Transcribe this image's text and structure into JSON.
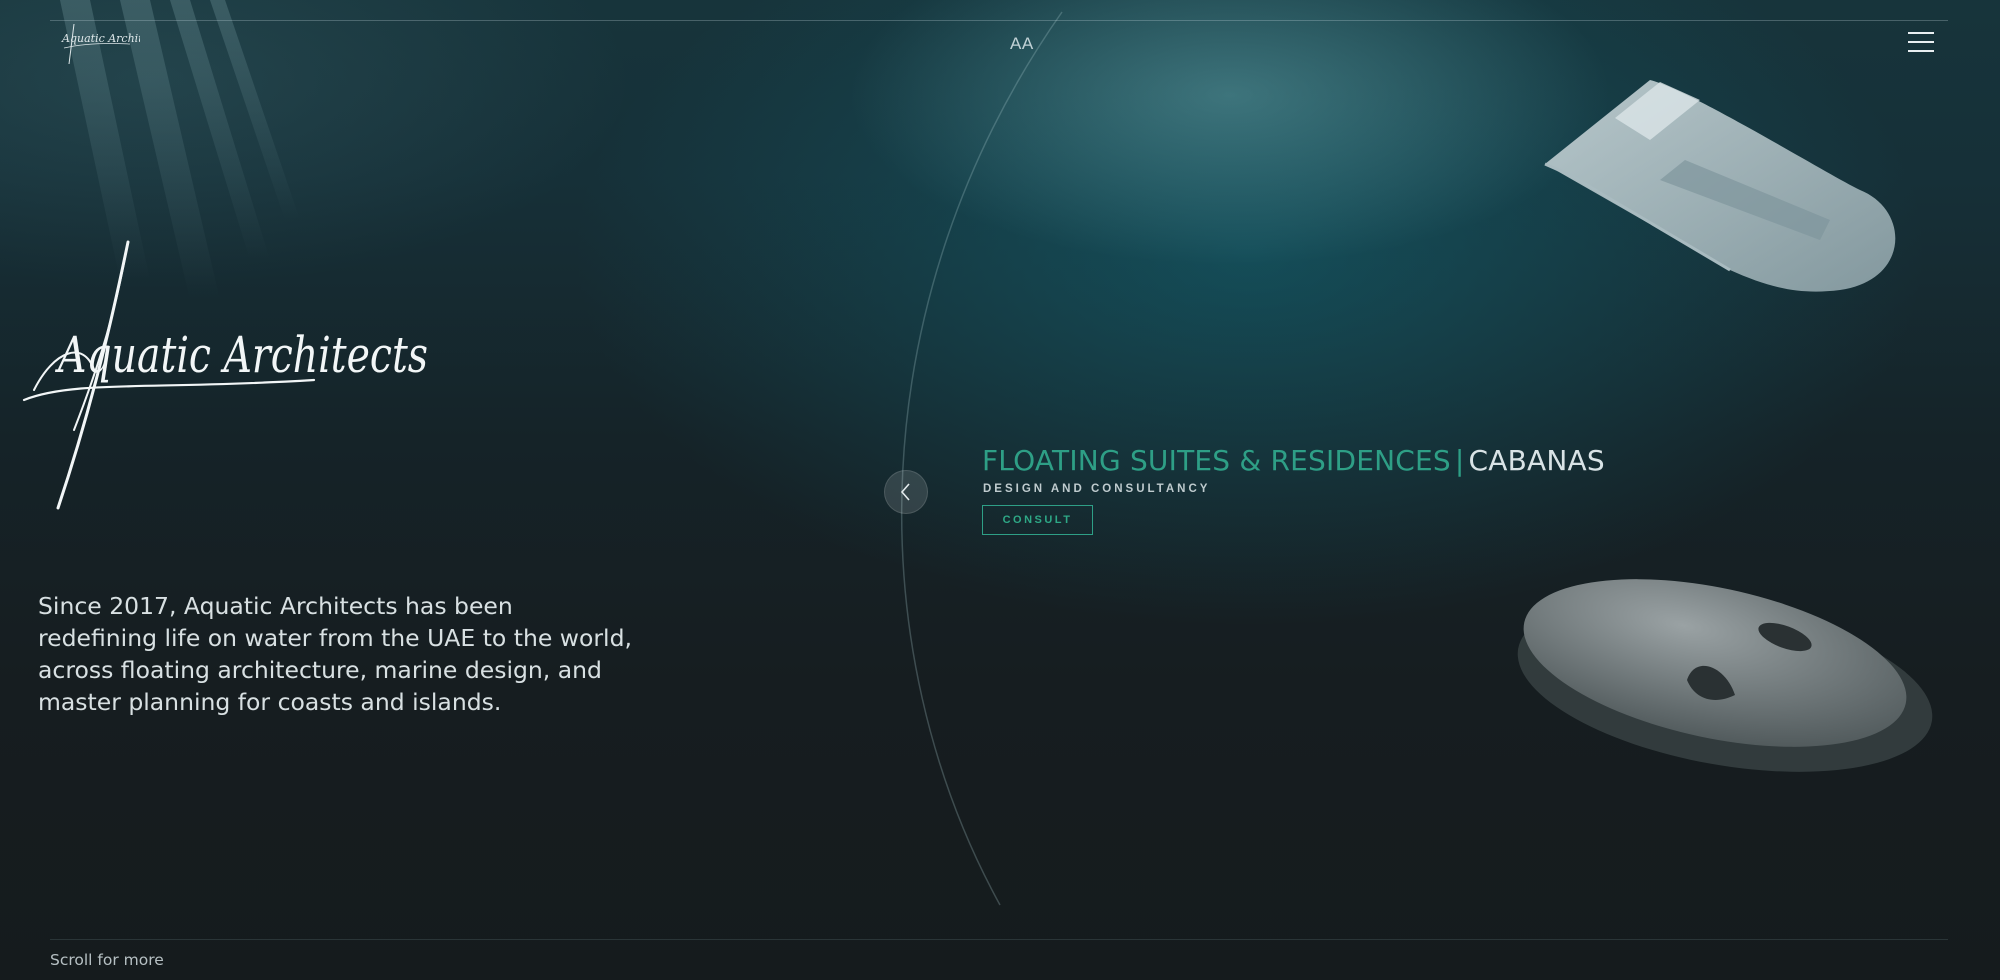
{
  "header": {
    "logo_text": "Aquatic Architects",
    "monogram": "AA",
    "menu_icon": "hamburger-menu-icon"
  },
  "hero": {
    "logo_text": "Aquatic Architects",
    "intro": "Since 2017, Aquatic Architects has been redefining life on water from the UAE to the world, across floating architecture, marine design, and master planning for coasts and islands."
  },
  "slider": {
    "prev_icon": "chevron-left-icon",
    "title_primary": "FLOATING SUITES & RESIDENCES",
    "title_separator": "|",
    "title_secondary": "CABANAS",
    "subtitle": "DESIGN AND CONSULTANCY",
    "cta_label": "CONSULT"
  },
  "footer": {
    "scroll_hint": "Scroll for more"
  },
  "colors": {
    "accent": "#2e9f86",
    "background": "#161c1f",
    "text": "#d8e0e2"
  }
}
